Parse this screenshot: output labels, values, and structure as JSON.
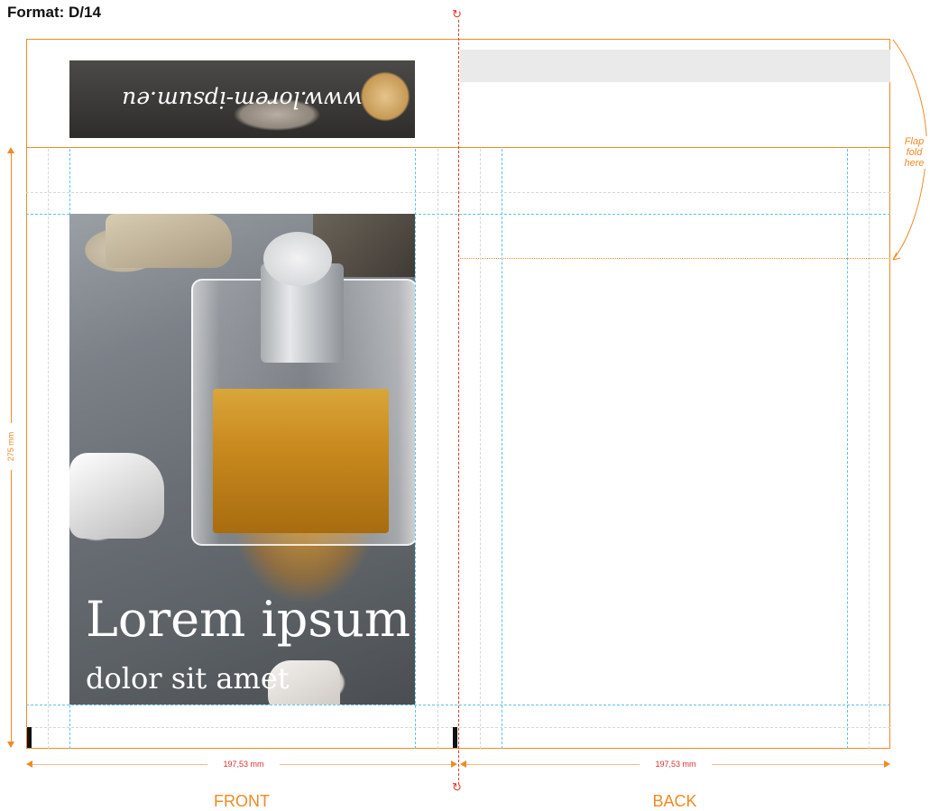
{
  "format_title": "Format: D/14",
  "banner": {
    "url_text": "www.lorem-ipsum.eu"
  },
  "cover": {
    "headline": "Lorem ipsum",
    "subline": "dolor sit amet"
  },
  "dimensions": {
    "height": "275 mm",
    "front_width": "197,53 mm",
    "back_width": "197,53 mm"
  },
  "labels": {
    "front": "FRONT",
    "back": "BACK"
  },
  "flap_note": {
    "line1": "Flap",
    "line2": "fold",
    "line3": "here"
  },
  "colors": {
    "trim": "#f08a24",
    "guide": "#5bc4e6",
    "dimension_text": "#d93030",
    "fold_mark": "#e03a2a"
  }
}
